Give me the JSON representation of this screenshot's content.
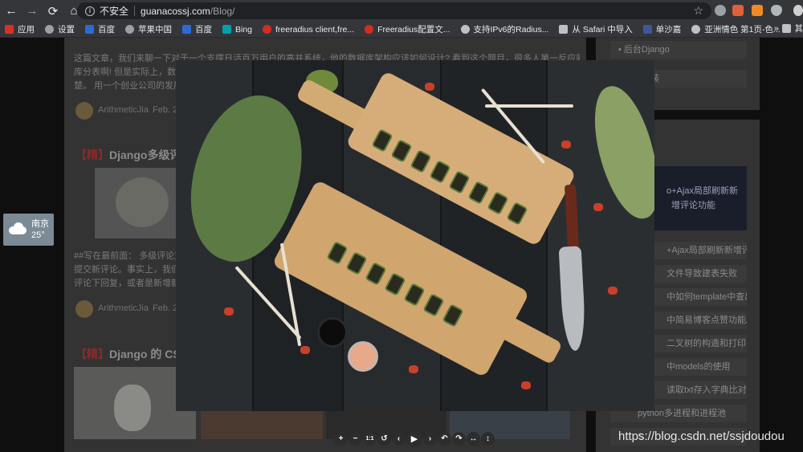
{
  "browser": {
    "back_icon": "←",
    "forward_icon": "→",
    "reload_icon": "⟳",
    "home_icon": "⌂",
    "security_label": "不安全",
    "url_host": "guanacossj.com",
    "url_path": "/Blog/",
    "star_icon": "☆"
  },
  "bookmarks": {
    "items": [
      {
        "label": "应用",
        "icon": "apps-icon",
        "color": "#d93025"
      },
      {
        "label": "设置",
        "icon": "gear-icon",
        "color": "#9aa0a6"
      },
      {
        "label": "百度",
        "icon": "baidu-icon",
        "color": "#2c6bd4"
      },
      {
        "label": "苹果中国",
        "icon": "apple-icon",
        "color": "#9aa0a6"
      },
      {
        "label": "百度",
        "icon": "baidu-icon",
        "color": "#2c6bd4"
      },
      {
        "label": "Bing",
        "icon": "bing-icon",
        "color": "#00a1a7"
      },
      {
        "label": "freeradius client,fre...",
        "icon": "csdn-icon",
        "color": "#d42d20"
      },
      {
        "label": "Freeradius配置文...",
        "icon": "csdn-icon",
        "color": "#d42d20"
      },
      {
        "label": "支持IPv6的Radius...",
        "icon": "globe-icon",
        "color": "#bdc1c6"
      },
      {
        "label": "从 Safari 中导入",
        "icon": "folder-icon",
        "color": "#bdc1c6"
      },
      {
        "label": "单沙嘉",
        "icon": "facebook-icon",
        "color": "#3b5998"
      },
      {
        "label": "亚洲情色 第1页-色...",
        "icon": "globe-icon",
        "color": "#bdc1c6"
      }
    ],
    "more": "»",
    "other_label": "其"
  },
  "page": {
    "intro_text_1": "这篇文章，我们来聊一下对于一个支撑日活百万用户的高并系统，他的数据库架构应该如何设计? 看到这个题目，很多人第一反应就是：分",
    "intro_text_2": "库分表啊! 但是实际上，数据",
    "intro_text_3": "楚。 用一个创业公司的发展",
    "post1_author": "ArithmeticJia",
    "post1_date": "Feb. 2",
    "post2_tag": "【精】",
    "post2_title": "Django多级评论",
    "post2_excerpt_1": "##写在最前面：  多级评论对",
    "post2_excerpt_2": "提交新评论。事实上，我们的",
    "post2_excerpt_3": "评论下回复，或者是新增新的",
    "post2_author": "ArithmeticJia",
    "post2_date": "Feb. 2",
    "post3_tag": "【精】",
    "post3_title": "Django 的 CSR"
  },
  "weather": {
    "city": "南京",
    "temp": "25°"
  },
  "sidebar": {
    "top_items": [
      "后台Django",
      "装"
    ],
    "banner_text_1": "o+Ajax局部刷新新",
    "banner_text_2": "增评论功能",
    "list": [
      "+Ajax局部刷新新增评...",
      "文件导致建表失败",
      "中如何template中查出...",
      "中简易博客点赞功能Aj...",
      "二叉树的构造和打印",
      "中models的使用",
      "读取txt存入字典比对xlxs",
      "python多进程和进程池",
      "S"
    ]
  },
  "viewer": {
    "buttons": [
      {
        "label": "+",
        "name": "zoom-in-button"
      },
      {
        "label": "−",
        "name": "zoom-out-button"
      },
      {
        "label": "1:1",
        "name": "one-to-one-button"
      },
      {
        "label": "↺",
        "name": "reset-button"
      },
      {
        "label": "‹",
        "name": "prev-button"
      },
      {
        "label": "▶",
        "name": "play-button"
      },
      {
        "label": "›",
        "name": "next-button"
      },
      {
        "label": "↶",
        "name": "rotate-left-button"
      },
      {
        "label": "↷",
        "name": "rotate-right-button"
      },
      {
        "label": "↔",
        "name": "flip-horizontal-button"
      },
      {
        "label": "↕",
        "name": "flip-vertical-button"
      }
    ]
  },
  "watermark": "https://blog.csdn.net/ssjdoudou"
}
